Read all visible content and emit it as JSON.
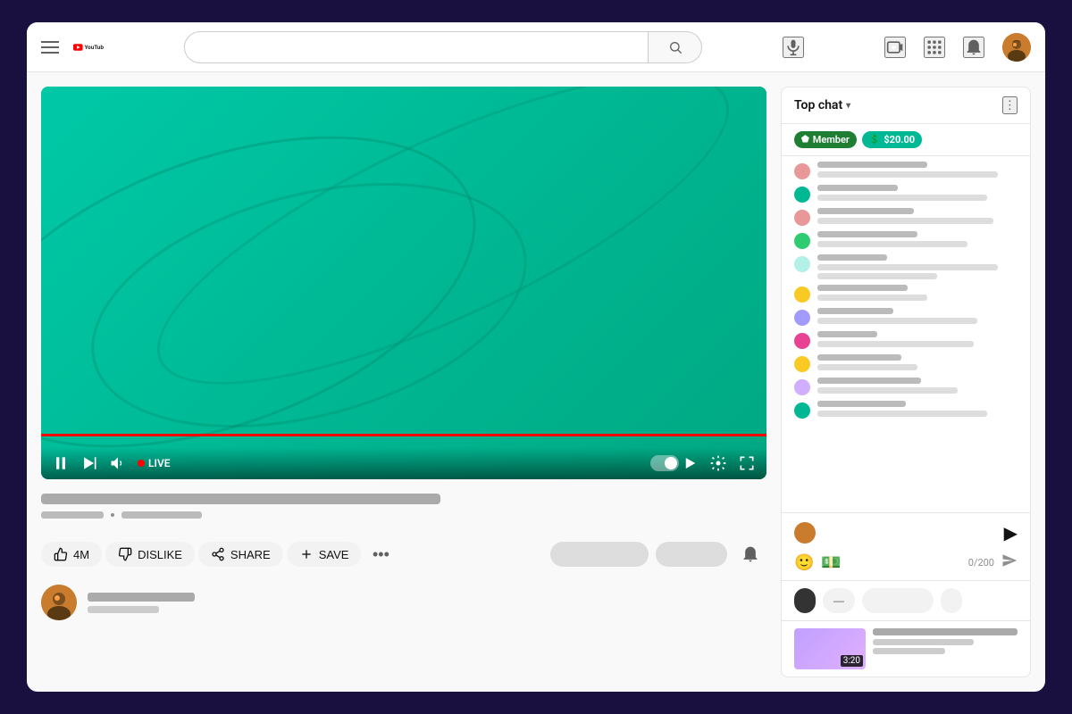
{
  "header": {
    "hamburger_label": "Menu",
    "logo_text": "YouTube",
    "search_placeholder": "",
    "mic_label": "Search by voice",
    "create_label": "Create",
    "apps_label": "YouTube apps",
    "notifications_label": "Notifications",
    "avatar_label": "Account"
  },
  "chat": {
    "title": "Top chat",
    "chevron": "▾",
    "more_label": "More options",
    "badge_member": "Member",
    "badge_super": "$20.00",
    "input_placeholder": "",
    "counter": "0/200",
    "filter_active": "",
    "filter_inactive1": "—",
    "filter_long": "",
    "filter_short": ""
  },
  "video": {
    "live_label": "LIVE",
    "like_count": "4M",
    "dislike_label": "DISLIKE",
    "share_label": "SHARE",
    "save_label": "SAVE",
    "duration": "3:20"
  },
  "colors": {
    "accent": "#ff0000",
    "bg": "#1a1040",
    "video_bg": "#00c9a7",
    "member_badge": "#1e7e34",
    "super_badge": "#00b894"
  }
}
